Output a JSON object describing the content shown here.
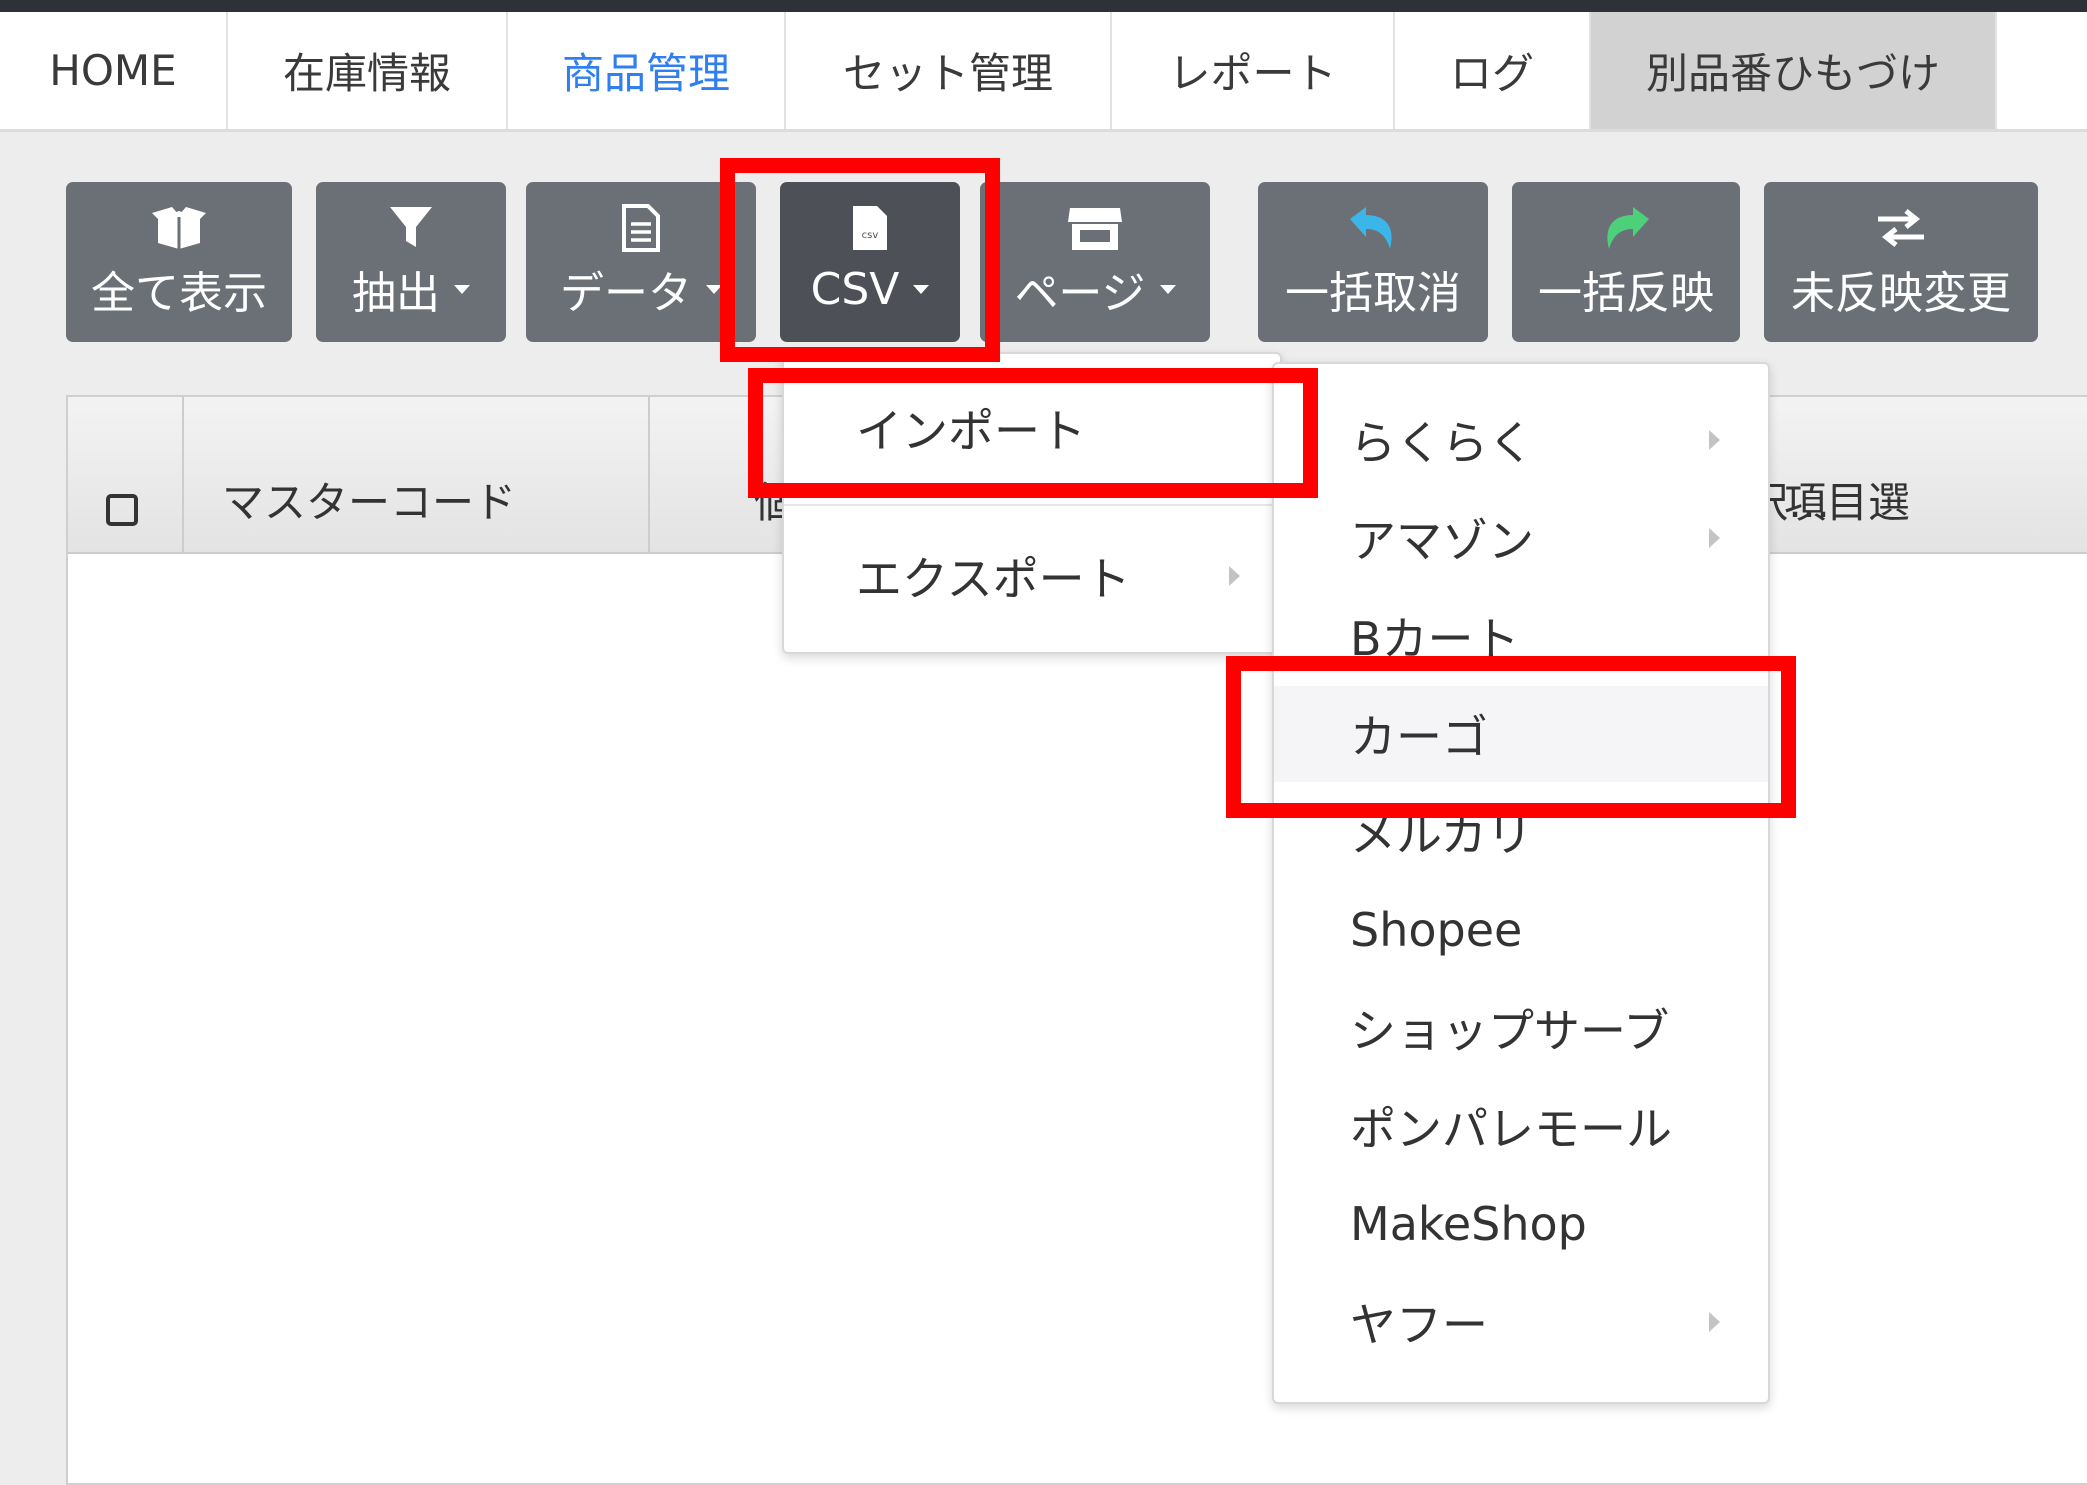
{
  "nav": {
    "tabs": [
      "HOME",
      "在庫情報",
      "商品管理",
      "セット管理",
      "レポート",
      "ログ",
      "別品番ひもづけ"
    ]
  },
  "toolbar": {
    "show_all": "全て表示",
    "extract": "抽出",
    "data": "データ",
    "csv": "CSV",
    "page": "ページ",
    "bulk_cancel": "一括取消",
    "bulk_apply": "一括反映",
    "unapplied_changes": "未反映変更",
    "csv_icon_text": "csv"
  },
  "grid": {
    "columns": [
      "マスターコード",
      "個別",
      "選択…",
      "項目選"
    ]
  },
  "csv_menu": {
    "import": "インポート",
    "export": "エクスポート"
  },
  "import_submenu": {
    "items": [
      "らくらく",
      "アマゾン",
      "Bカート",
      "カーゴ",
      "メルカリ",
      "Shopee",
      "ショップサーブ",
      "ポンパレモール",
      "MakeShop",
      "ヤフー"
    ]
  },
  "colors": {
    "highlight": "#ff0000",
    "active_tab": "#2f7ff0",
    "undo_icon": "#3cb6e8",
    "redo_icon": "#4cd17a"
  }
}
